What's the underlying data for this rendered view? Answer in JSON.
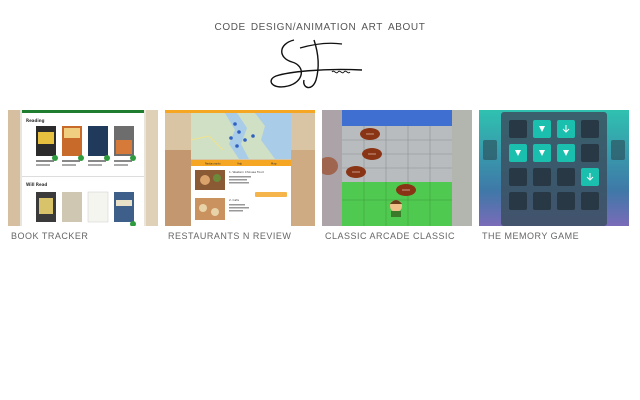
{
  "nav": {
    "code": "CODE",
    "design_animation": "DESIGN/ANIMATION",
    "art": "ART",
    "about": "ABOUT"
  },
  "projects": [
    {
      "title": "BOOK TRACKER",
      "thumb": {
        "section1": "Reading",
        "section2": "Will Read"
      }
    },
    {
      "title": "RESTAURANTS N REVIEW",
      "thumb": {
        "tabs": [
          "Restaurants",
          "Yelp",
          "Map"
        ],
        "listing1": "1. Western Chinese Food",
        "listing2": "2. Cafe"
      }
    },
    {
      "title": "CLASSIC ARCADE CLASSIC"
    },
    {
      "title": "THE MEMORY GAME"
    }
  ],
  "colors": {
    "text": "#555555",
    "book_accent": "#1e7d2e",
    "restaurant_accent": "#f5a623",
    "water": "#3f6fd1",
    "grass": "#4fc94f",
    "memory_teal": "#1bbfae"
  }
}
